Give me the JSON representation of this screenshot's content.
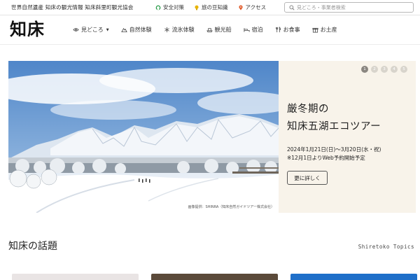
{
  "topbar": {
    "site_description": "世界自然遺産 知床の観光情報 知床斜里町観光協会",
    "links": [
      {
        "label": "安全対策",
        "icon": "shield-icon",
        "color": "#2a9d4a"
      },
      {
        "label": "旅の豆知識",
        "icon": "lightbulb-icon",
        "color": "#e8b400"
      },
      {
        "label": "アクセス",
        "icon": "pin-icon",
        "color": "#e05a2a"
      }
    ],
    "search_placeholder": "見どころ・事業者検索"
  },
  "header": {
    "logo": "知床"
  },
  "nav": {
    "items": [
      {
        "label": "見どころ",
        "icon": "eye-icon",
        "dropdown": true
      },
      {
        "label": "自然体験",
        "icon": "mountain-icon",
        "dropdown": false
      },
      {
        "label": "流氷体験",
        "icon": "snowflake-icon",
        "dropdown": false
      },
      {
        "label": "観光船",
        "icon": "ship-icon",
        "dropdown": false
      },
      {
        "label": "宿泊",
        "icon": "bed-icon",
        "dropdown": false
      },
      {
        "label": "お食事",
        "icon": "utensils-icon",
        "dropdown": false
      },
      {
        "label": "お土産",
        "icon": "gift-icon",
        "dropdown": false
      }
    ]
  },
  "hero": {
    "title_line1": "厳冬期の",
    "title_line2": "知床五湖エコツアー",
    "date_line1": "2024年1月21日(日)〜3月20日(水・祝)",
    "date_line2": "※12月1日よりWeb予約開始予定",
    "button_label": "更に詳しく",
    "photo_credit": "画像提供：SHINRA（知床自然ガイドツアー株式会社）",
    "slides": [
      "1",
      "2",
      "3",
      "4",
      "5"
    ],
    "active_slide": 1,
    "panel_color": "#f8f3ea"
  },
  "topics": {
    "title": "知床の話題",
    "subtitle": "Shiretoko Topics",
    "card_colors": [
      "#e9e4e4",
      "#5b4a3a",
      "#1f6fc9"
    ]
  }
}
